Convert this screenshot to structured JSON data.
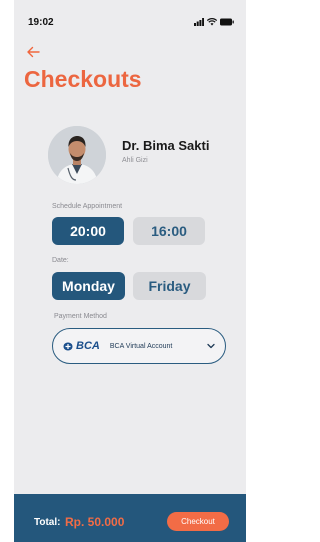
{
  "status_bar": {
    "time": "19:02"
  },
  "header": {
    "back_icon": "arrow-left-icon",
    "title": "Checkouts"
  },
  "doctor": {
    "name": "Dr. Bima Sakti",
    "role": "Ahli Gizi"
  },
  "schedule": {
    "label": "Schedule Appointment",
    "options": [
      {
        "label": "20:00",
        "selected": true
      },
      {
        "label": "16:00",
        "selected": false
      }
    ]
  },
  "date": {
    "label": "Date:",
    "options": [
      {
        "label": "Monday",
        "selected": true
      },
      {
        "label": "Friday",
        "selected": false
      }
    ]
  },
  "payment": {
    "label": "Payment Method",
    "bank_logo": "BCA",
    "selected": "BCA Virtual Account",
    "chevron_icon": "chevron-down-icon"
  },
  "footer": {
    "total_label": "Total:",
    "total_value": "Rp. 50.000",
    "checkout_label": "Checkout"
  },
  "colors": {
    "accent": "#ec6640",
    "primary": "#24577c",
    "background": "#ececee"
  }
}
